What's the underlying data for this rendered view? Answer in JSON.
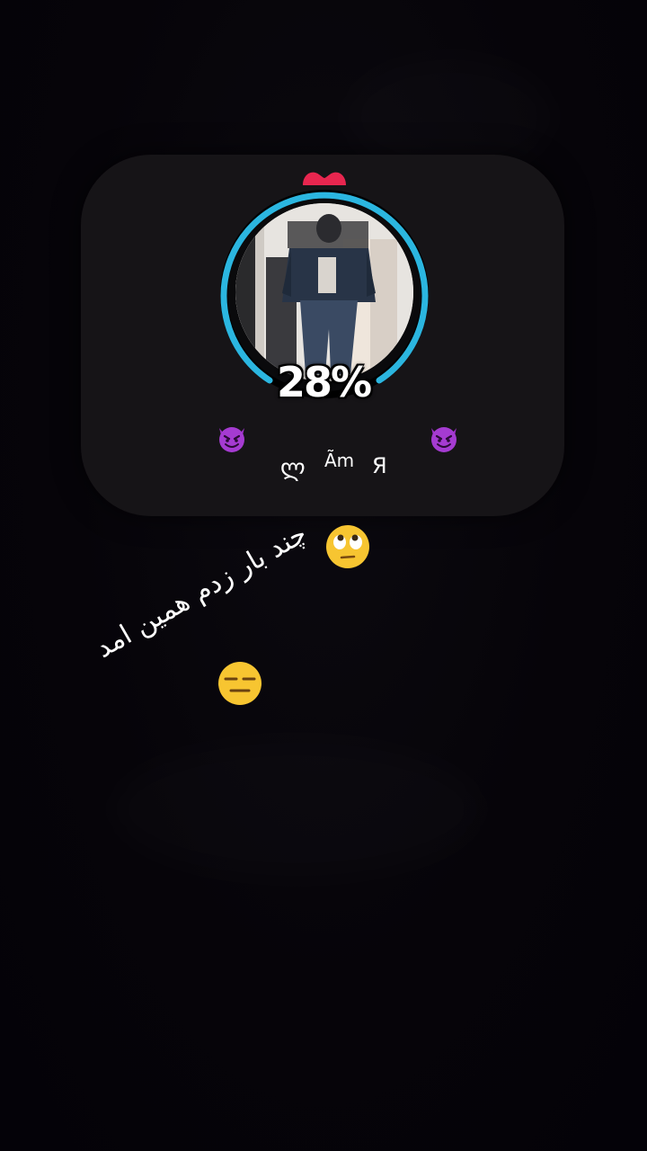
{
  "widget": {
    "progress_percent": 28,
    "percent_label": "28%",
    "ring_color": "#2bb6e0",
    "heart_color": "#e8264f",
    "left_glyph": "ლ",
    "middle_glyph": "Ãm",
    "right_glyph": "Я"
  },
  "caption": {
    "text": "چند بار زدم همین امد"
  },
  "emojis": {
    "devil_left": "smiling-devil",
    "devil_right": "smiling-devil",
    "eye_roll": "face-with-rolling-eyes",
    "expressionless": "expressionless-face"
  }
}
